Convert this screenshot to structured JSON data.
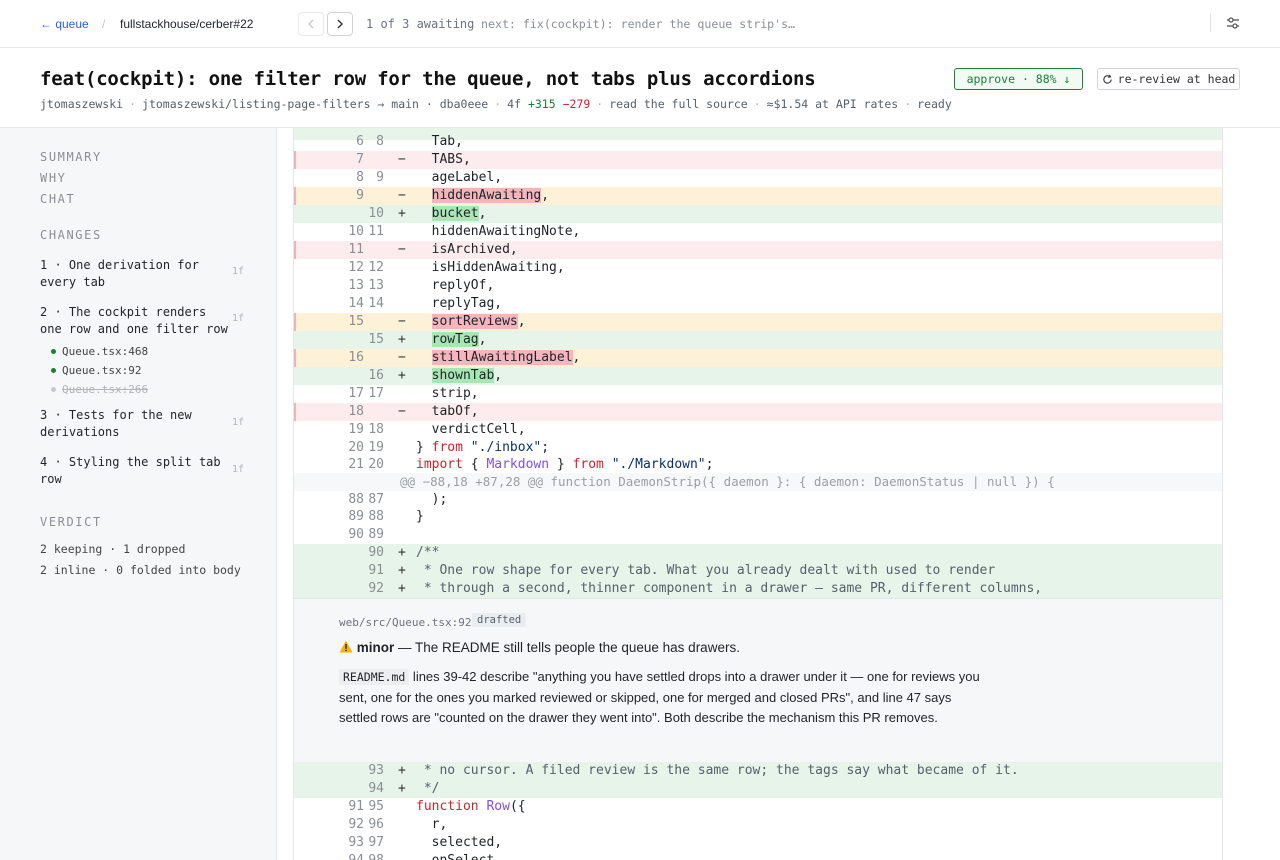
{
  "topbar": {
    "back_label": "← queue",
    "separator": "/",
    "repo": "fullstackhouse/cerber#22",
    "awaiting": "1 of 3 awaiting",
    "next": "next: fix(cockpit): render the queue strip's…",
    "icons": {
      "prev": "chevron-left-icon",
      "next": "chevron-right-icon",
      "settings": "sliders-icon"
    }
  },
  "header": {
    "title": "feat(cockpit): one filter row for the queue, not tabs plus accordions",
    "approve_badge": "approve · 88% ↓",
    "rereview_label": "re-review at head",
    "meta": {
      "author": "jtomaszewski",
      "branch": "jtomaszewski/listing-page-filters → main · dba0eee",
      "files": "4f",
      "additions": "+315",
      "deletions": "−279",
      "source_link": "read the full source",
      "cost": "≈$1.54 at API rates",
      "status": "ready"
    }
  },
  "sidebar": {
    "nav": [
      "SUMMARY",
      "WHY",
      "CHAT"
    ],
    "changes_label": "CHANGES",
    "changes": [
      {
        "label": "1 · One derivation for every tab",
        "count": "1f"
      },
      {
        "label": "2 · The cockpit renders one row and one filter row",
        "count": "1f"
      },
      {
        "label": "3 · Tests for the new derivations",
        "count": "1f"
      },
      {
        "label": "4 · Styling the split tab row",
        "count": "1f"
      }
    ],
    "files": [
      "Queue.tsx:468",
      "Queue.tsx:92",
      "Queue.tsx:266"
    ],
    "verdict_label": "VERDICT",
    "verdict_lines": [
      "2 keeping · 1 dropped",
      "2 inline · 0 folded into body"
    ]
  },
  "diff": {
    "hunk": "@@ −88,18 +87,28 @@ function DaemonStrip({ daemon }: { daemon: DaemonStatus | null }) {",
    "comment": {
      "location": "web/src/Queue.tsx:92",
      "status": "drafted",
      "severity_icon": "warning-icon",
      "severity": "minor",
      "headline": " — The README still tells people the queue has drawers.",
      "code": "README.md",
      "body": " lines 39-42 describe \"anything you have settled drops into a drawer under it — one for reviews you sent, one for the ones you marked reviewed or skipped, one for merged and closed PRs\", and line 47 says settled rows are \"counted on the drawer they went into\". Both describe the mechanism this PR removes."
    }
  },
  "colors": {
    "accent": "#2563eb",
    "add": "#1a7f37",
    "del": "#cf222e",
    "row_add": "#e6f4ea",
    "row_del": "#fdecee",
    "row_mod": "#fdf1d8"
  }
}
